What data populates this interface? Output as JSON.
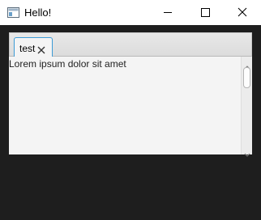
{
  "window": {
    "title": "Hello!",
    "icon": "java-app-icon"
  },
  "controls": {
    "minimize_icon": "minimize-icon",
    "maximize_icon": "maximize-icon",
    "close_icon": "close-icon"
  },
  "tabs": [
    {
      "label": "test",
      "close_icon": "close-icon",
      "selected": true
    }
  ],
  "content": {
    "text": "Lorem ipsum dolor sit amet"
  },
  "colors": {
    "window_background": "#1e1e1e",
    "tab_accent": "#3c9bd6",
    "pane_background": "#f4f4f4"
  }
}
